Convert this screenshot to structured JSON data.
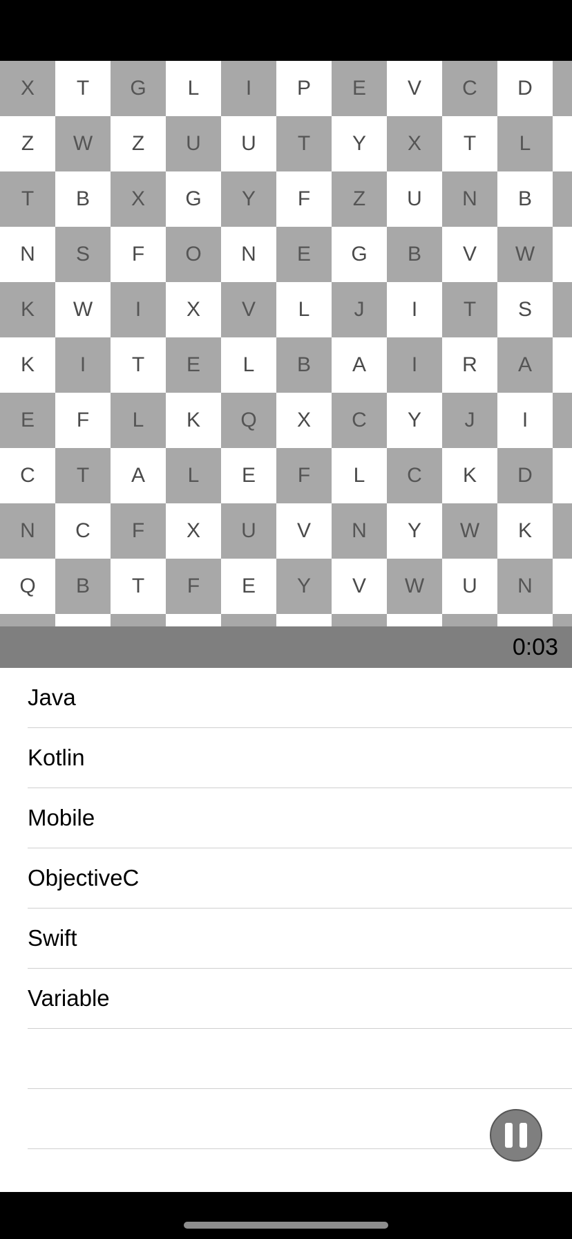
{
  "grid": {
    "rows": [
      [
        "X",
        "T",
        "G",
        "L",
        "I",
        "P",
        "E",
        "V",
        "C",
        "D",
        ""
      ],
      [
        "Z",
        "W",
        "Z",
        "U",
        "U",
        "T",
        "Y",
        "X",
        "T",
        "L",
        ""
      ],
      [
        "T",
        "B",
        "X",
        "G",
        "Y",
        "F",
        "Z",
        "U",
        "N",
        "B",
        ""
      ],
      [
        "N",
        "S",
        "F",
        "O",
        "N",
        "E",
        "G",
        "B",
        "V",
        "W",
        ""
      ],
      [
        "K",
        "W",
        "I",
        "X",
        "V",
        "L",
        "J",
        "I",
        "T",
        "S",
        ""
      ],
      [
        "K",
        "I",
        "T",
        "E",
        "L",
        "B",
        "A",
        "I",
        "R",
        "A",
        ""
      ],
      [
        "E",
        "F",
        "L",
        "K",
        "Q",
        "X",
        "C",
        "Y",
        "J",
        "I",
        ""
      ],
      [
        "C",
        "T",
        "A",
        "L",
        "E",
        "F",
        "L",
        "C",
        "K",
        "D",
        ""
      ],
      [
        "N",
        "C",
        "F",
        "X",
        "U",
        "V",
        "N",
        "Y",
        "W",
        "K",
        ""
      ],
      [
        "Q",
        "B",
        "T",
        "F",
        "E",
        "Y",
        "V",
        "W",
        "U",
        "N",
        ""
      ],
      [
        "",
        "",
        "",
        "",
        "",
        "",
        "",
        "",
        "",
        "",
        ""
      ]
    ]
  },
  "timer": {
    "text": "0:03"
  },
  "words": [
    "Java",
    "Kotlin",
    "Mobile",
    "ObjectiveC",
    "Swift",
    "Variable",
    "",
    ""
  ],
  "icons": {
    "pause": "pause-icon"
  },
  "colors": {
    "dark_cell": "#a8a8a8",
    "light_cell": "#ffffff",
    "timer_bar": "#7f7f7f",
    "pause_button": "#7f7f7f"
  }
}
